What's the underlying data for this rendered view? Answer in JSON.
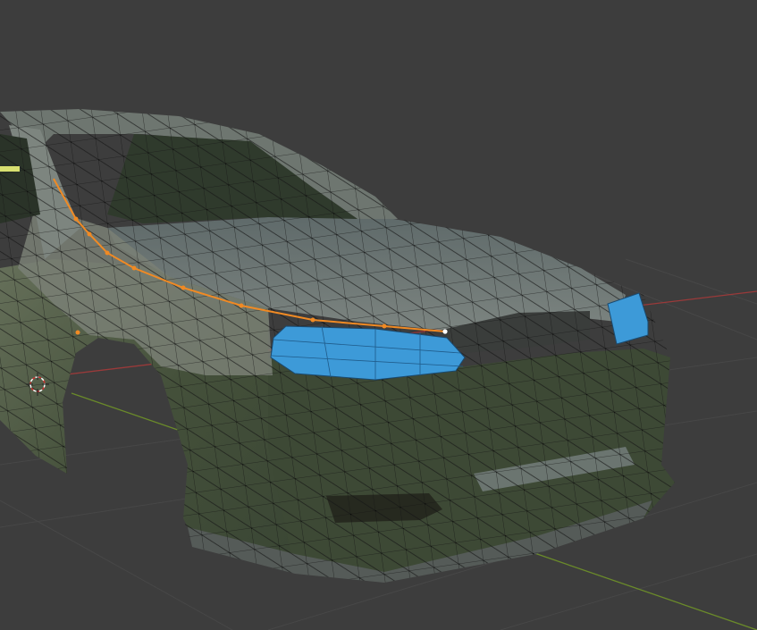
{
  "viewport": {
    "mode": "edit-mode",
    "background_color": "#3d3d3d",
    "grid_color": "#474747",
    "x_axis_color": "#9a3a3a",
    "y_axis_color": "#6a8a2a"
  },
  "mesh": {
    "body_color": "#3f4a33",
    "hood_color": "#6c7575",
    "window_color": "#2f3a2c",
    "wire_color": "#111111",
    "selected_face_color": "#3d9ad8",
    "selected_edge_color": "#f08a24",
    "active_vertex_color": "#ffffff"
  },
  "icons": [
    "3d-cursor-icon"
  ]
}
